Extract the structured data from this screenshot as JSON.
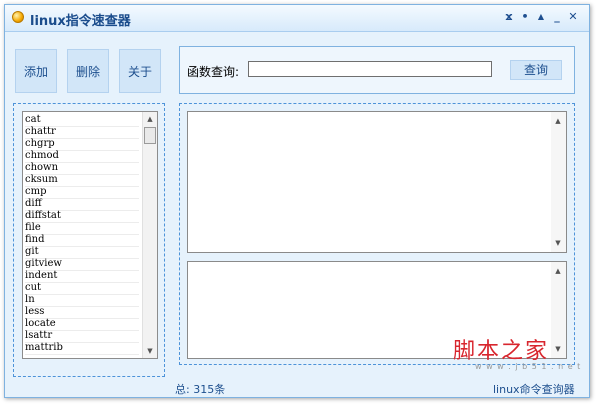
{
  "window": {
    "title": "linux指令速查器",
    "controls": [
      "ϫ",
      "•",
      "▲",
      "_",
      "✕"
    ]
  },
  "toolbar": {
    "add_label": "添加",
    "delete_label": "删除",
    "about_label": "关于"
  },
  "search": {
    "label": "函数查询:",
    "value": "",
    "button_label": "查询"
  },
  "command_list": {
    "items": [
      "cat",
      "chattr",
      "chgrp",
      "chmod",
      "chown",
      "cksum",
      "cmp",
      "diff",
      "diffstat",
      "file",
      "find",
      "git",
      "gitview",
      "indent",
      "cut",
      "ln",
      "less",
      "locate",
      "lsattr",
      "mattrib"
    ]
  },
  "status": {
    "total": "总: 315条",
    "app_name": "linux命令查询器"
  },
  "watermark": {
    "text": "脚本之家",
    "url": "w w w . j b 5 1 . n e t"
  }
}
